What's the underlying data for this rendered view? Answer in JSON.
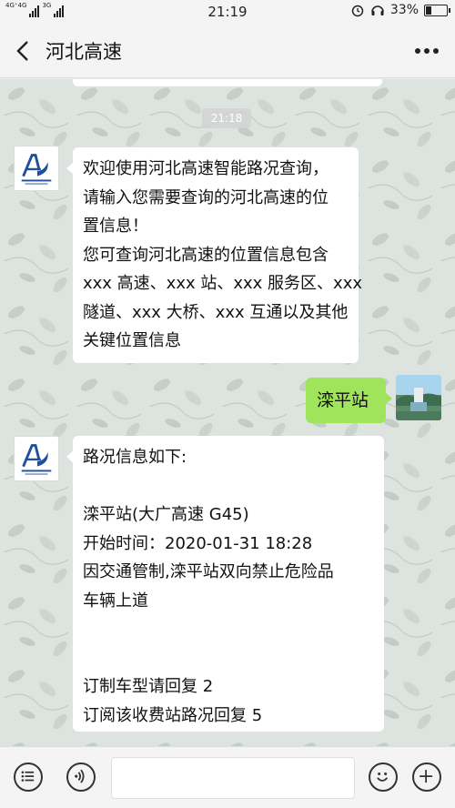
{
  "status_bar": {
    "network_label_1": "4G⁺4G",
    "network_label_2": "3G",
    "time": "21:19",
    "battery": "33%",
    "battery_level": 0.33
  },
  "nav": {
    "title": "河北高速"
  },
  "chat": {
    "timestamp": "21:18",
    "messages": [
      {
        "sender": "bot",
        "lines": [
          "欢迎使用河北高速智能路况查询，",
          "请输入您需要查询的河北高速的位",
          "置信息！",
          "您可查询河北高速的位置信息包含",
          "xxx 高速、xxx 站、xxx 服务区、xxx",
          "隧道、xxx 大桥、xxx 互通以及其他",
          "关键位置信息"
        ]
      },
      {
        "sender": "user",
        "text": "滦平站"
      },
      {
        "sender": "bot",
        "lines": [
          "路况信息如下:",
          "",
          "滦平站(大广高速 G45)",
          "开始时间：2020-01-31 18:28",
          "因交通管制,滦平站双向禁止危险品",
          "车辆上道",
          "",
          "",
          "订制车型请回复 2",
          "订阅该收费站路况回复 5"
        ]
      }
    ]
  },
  "input_bar": {
    "value": "",
    "placeholder": ""
  },
  "icons": {
    "back": "chevron-left-icon",
    "menu": "more-dots-icon",
    "list": "list-menu-icon",
    "voice": "voice-icon",
    "emoji": "emoji-icon",
    "add": "plus-icon"
  }
}
